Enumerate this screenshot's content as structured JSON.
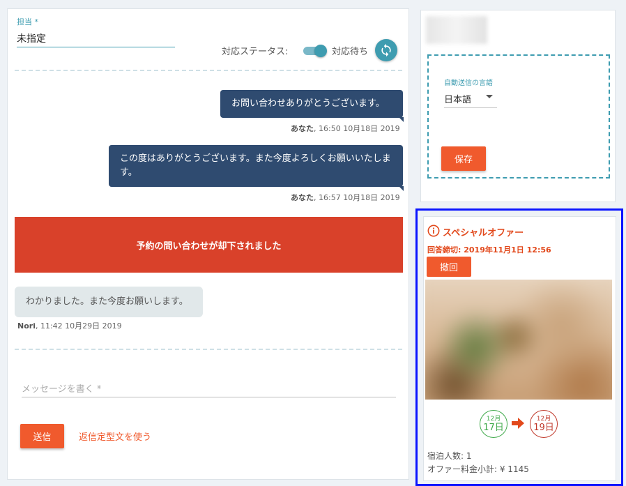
{
  "assignee": {
    "label": "担当 *",
    "value": "未指定"
  },
  "status": {
    "label": "対応ステータス:",
    "value": "対応待ち",
    "toggle_on": true
  },
  "messages": [
    {
      "text": "お問い合わせありがとうございます。",
      "sender": "あなた",
      "time": ", 16:50 10月18日 2019"
    },
    {
      "text": "この度はありがとうございます。また今度よろしくお願いいたします。",
      "sender": "あなた",
      "time": ", 16:57 10月18日 2019"
    },
    {
      "banner": "予約の問い合わせが却下されました"
    },
    {
      "text": "わかりました。また今度お願いします。",
      "sender": "Nori",
      "time": ", 11:42 10月29日 2019"
    }
  ],
  "composer": {
    "placeholder": "メッセージを書く *",
    "send_label": "送信",
    "template_link": "返信定型文を使う"
  },
  "auto_reply": {
    "label": "自動送信の言語",
    "value": "日本語",
    "save_label": "保存"
  },
  "offer": {
    "title": "スペシャルオファー",
    "deadline": "回答締切: 2019年11月1日 12:56",
    "withdraw_label": "撤回",
    "checkin": {
      "month": "12月",
      "day": "17日"
    },
    "checkout": {
      "month": "12月",
      "day": "19日"
    },
    "guests": "宿泊人数: 1",
    "subtotal": "オファー料金小計: ¥ 1145"
  },
  "colors": {
    "accent": "#3e9cb0",
    "primary_button": "#f05a2d",
    "outgoing_bubble": "#2f4b70",
    "decline_banner": "#d9412a",
    "highlight_border": "#0a14ff"
  },
  "icons": {
    "refresh": "refresh-icon",
    "info": "info-icon",
    "arrow": "arrow-right-icon",
    "dropdown": "caret-down-icon"
  }
}
